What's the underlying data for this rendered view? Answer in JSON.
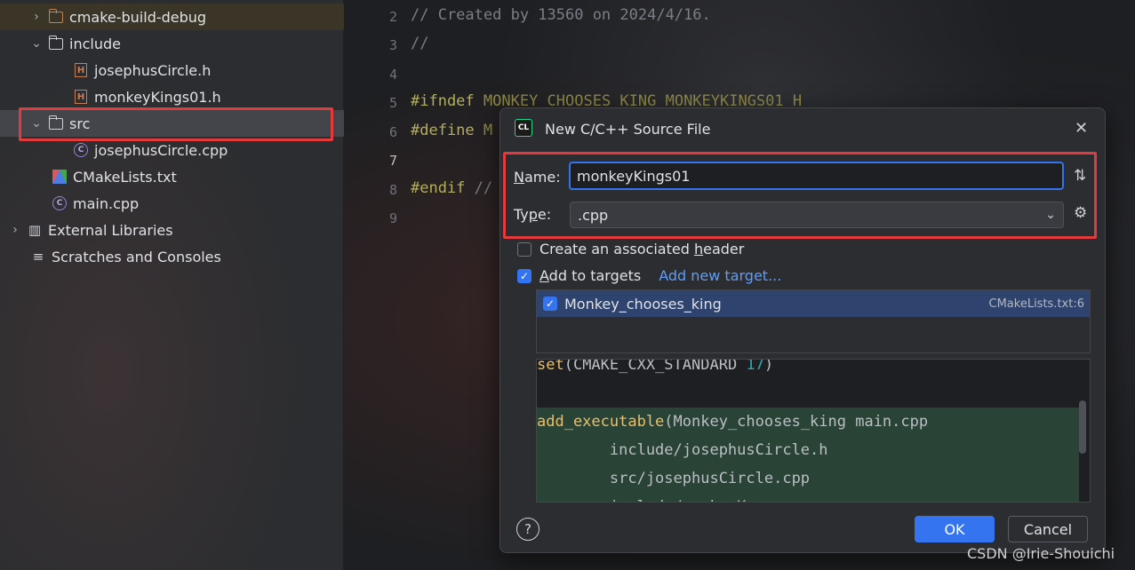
{
  "project_tree": {
    "items": [
      {
        "label": "cmake-build-debug",
        "icon": "folder-icon",
        "expanded": false
      },
      {
        "label": "include",
        "icon": "folder-icon",
        "expanded": true
      },
      {
        "label": "josephusCircle.h",
        "icon": "header-file-icon"
      },
      {
        "label": "monkeyKings01.h",
        "icon": "header-file-icon"
      },
      {
        "label": "src",
        "icon": "folder-icon",
        "expanded": true,
        "selected": true
      },
      {
        "label": "josephusCircle.cpp",
        "icon": "cpp-file-icon"
      },
      {
        "label": "CMakeLists.txt",
        "icon": "cmake-icon"
      },
      {
        "label": "main.cpp",
        "icon": "cpp-file-icon"
      },
      {
        "label": "External Libraries",
        "icon": "library-icon",
        "expanded": false
      },
      {
        "label": "Scratches and Consoles",
        "icon": "scratches-icon"
      }
    ]
  },
  "editor": {
    "lines": [
      {
        "num": "2",
        "text": "// Created by 13560 on 2024/4/16."
      },
      {
        "num": "3",
        "text": "//"
      },
      {
        "num": "4",
        "text": ""
      },
      {
        "num": "5",
        "keyword": "#ifndef",
        "macro": "MONKEY_CHOOSES_KING_MONKEYKINGS01_H"
      },
      {
        "num": "6",
        "keyword": "#define",
        "macro": "M"
      },
      {
        "num": "7",
        "text": ""
      },
      {
        "num": "8",
        "keyword": "#endif",
        "macro": "//"
      },
      {
        "num": "9",
        "text": ""
      }
    ]
  },
  "dialog": {
    "title": "New C/C++ Source File",
    "logo_text": "CL",
    "name_label": "Name:",
    "name_value": "monkeyKings01",
    "type_label": "Type:",
    "type_value": ".cpp",
    "create_header_label": "Create an associated header",
    "create_header_checked": false,
    "add_targets_label": "Add to targets",
    "add_targets_checked": true,
    "add_new_target_link": "Add new target...",
    "targets": [
      {
        "name": "Monkey_chooses_king",
        "file": "CMakeLists.txt:6",
        "checked": true
      }
    ],
    "preview": {
      "line1_fn": "set",
      "line1_args": "(CMAKE_CXX_STANDARD ",
      "line1_num": "17",
      "line1_close": ")",
      "line2_fn": "add_executable",
      "line2_args": "(Monkey_chooses_king main.cpp",
      "line3": "        include/josephusCircle.h",
      "line4": "        src/josephusCircle.cpp",
      "line5": "        include/monkeyK"
    },
    "help_label": "?",
    "ok_label": "OK",
    "cancel_label": "Cancel"
  },
  "watermark": "CSDN @Irie-Shouichi",
  "colors": {
    "accent": "#3574f0",
    "highlight_box": "#e33b3b",
    "link": "#5e9df9",
    "added_line": "#294436"
  }
}
